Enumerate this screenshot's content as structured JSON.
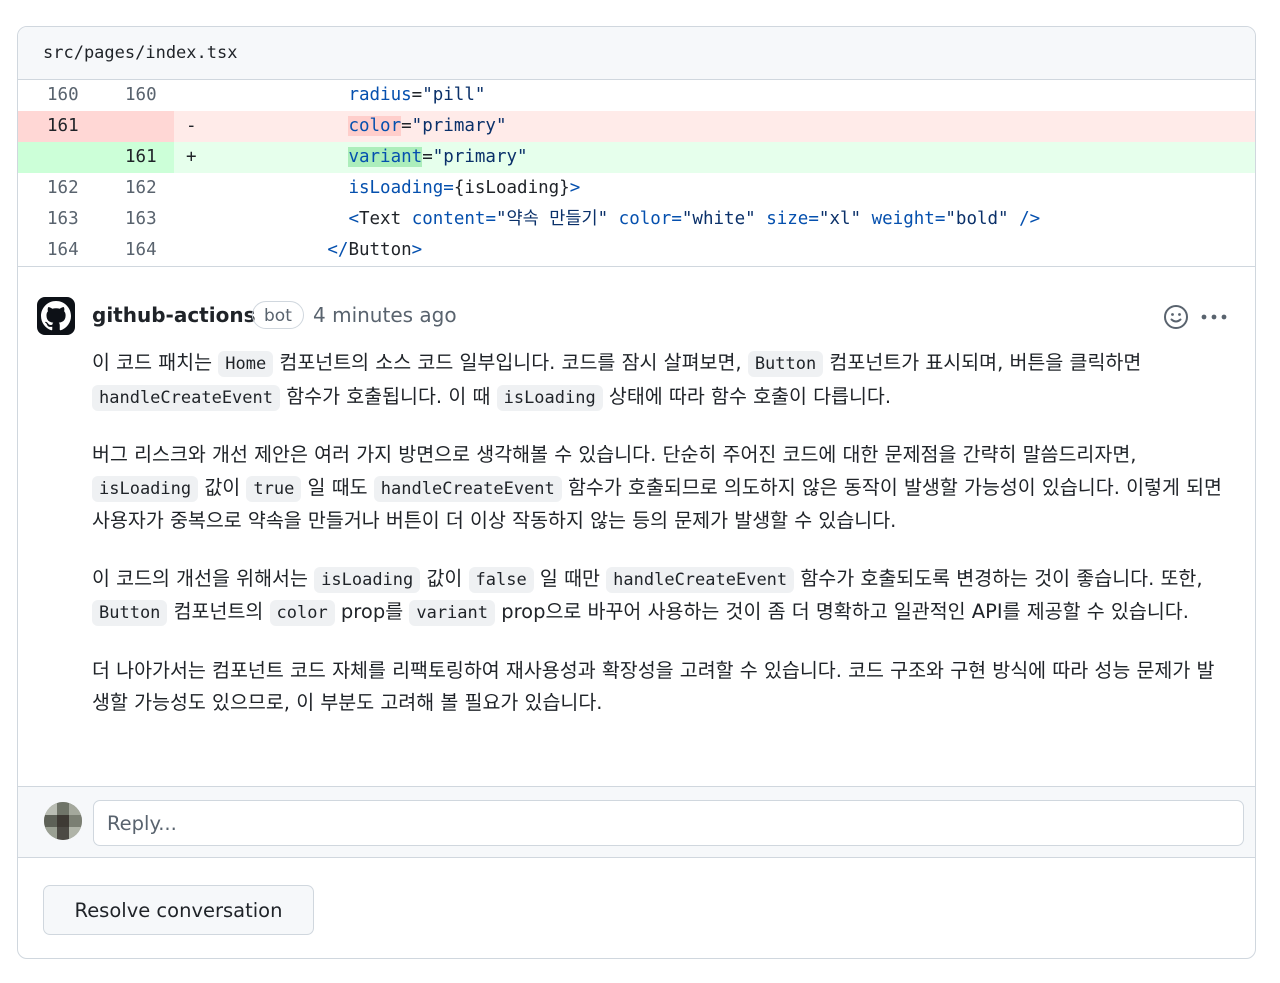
{
  "file": {
    "path": "src/pages/index.tsx"
  },
  "diff": {
    "lines": [
      {
        "old": "160",
        "new": "160",
        "marker": "",
        "type": "context"
      },
      {
        "old": "161",
        "new": "",
        "marker": "-",
        "type": "del"
      },
      {
        "old": "",
        "new": "161",
        "marker": "+",
        "type": "add"
      },
      {
        "old": "162",
        "new": "162",
        "marker": "",
        "type": "context"
      },
      {
        "old": "163",
        "new": "163",
        "marker": "",
        "type": "context"
      },
      {
        "old": "164",
        "new": "164",
        "marker": "",
        "type": "context"
      }
    ],
    "code": {
      "l1_attr": "radius",
      "l1_eq": "=",
      "l1_val": "\"pill\"",
      "l2_attr": "color",
      "l2_eq": "=",
      "l2_val": "\"primary\"",
      "l3_attr": "variant",
      "l3_eq": "=",
      "l3_val": "\"primary\"",
      "l4_attr": "isLoading",
      "l4_eq": "=",
      "l4_val": "{isLoading}",
      "l4_close": ">",
      "l5_open": "<",
      "l5_tag": "Text",
      "l5_a1": "content",
      "l5_v1": "\"약속 만들기\"",
      "l5_a2": "color",
      "l5_v2": "\"white\"",
      "l5_a3": "size",
      "l5_v3": "\"xl\"",
      "l5_a4": "weight",
      "l5_v4": "\"bold\"",
      "l5_end": "/>",
      "l6_open": "</",
      "l6_tag": "Button",
      "l6_close": ">"
    }
  },
  "comment": {
    "author": "github-actions",
    "badge": "bot",
    "time": "4 minutes ago",
    "p1": {
      "t1": "이 코드 패치는 ",
      "c1": "Home",
      "t2": " 컴포넌트의 소스 코드 일부입니다. 코드를 잠시 살펴보면, ",
      "c2": "Button",
      "t3": " 컴포넌트가 표시되며, 버튼을 클릭하면 ",
      "c3": "handleCreateEvent",
      "t4": " 함수가 호출됩니다. 이 때 ",
      "c4": "isLoading",
      "t5": " 상태에 따라 함수 호출이 다릅니다."
    },
    "p2": {
      "t1": "버그 리스크와 개선 제안은 여러 가지 방면으로 생각해볼 수 있습니다. 단순히 주어진 코드에 대한 문제점을 간략히 말씀드리자면, ",
      "c1": "isLoading",
      "t2": " 값이 ",
      "c2": "true",
      "t3": " 일 때도 ",
      "c3": "handleCreateEvent",
      "t4": " 함수가 호출되므로 의도하지 않은 동작이 발생할 가능성이 있습니다. 이렇게 되면 사용자가 중복으로 약속을 만들거나 버튼이 더 이상 작동하지 않는 등의 문제가 발생할 수 있습니다."
    },
    "p3": {
      "t1": "이 코드의 개선을 위해서는 ",
      "c1": "isLoading",
      "t2": " 값이 ",
      "c2": "false",
      "t3": " 일 때만 ",
      "c3": "handleCreateEvent",
      "t4": " 함수가 호출되도록 변경하는 것이 좋습니다. 또한, ",
      "c4": "Button",
      "t5": " 컴포넌트의 ",
      "c5": "color",
      "t6": " prop를 ",
      "c6": "variant",
      "t7": " prop으로 바꾸어 사용하는 것이 좀 더 명확하고 일관적인 API를 제공할 수 있습니다."
    },
    "p4": {
      "t1": "더 나아가서는 컴포넌트 코드 자체를 리팩토링하여 재사용성과 확장성을 고려할 수 있습니다. 코드 구조와 구현 방식에 따라 성능 문제가 발생할 가능성도 있으므로, 이 부분도 고려해 볼 필요가 있습니다."
    }
  },
  "reply": {
    "placeholder": "Reply..."
  },
  "actions": {
    "resolve_label": "Resolve conversation"
  },
  "icons": {
    "author_avatar": "github-mark-icon",
    "emoji": "smiley-icon",
    "more": "kebab-horizontal-icon"
  },
  "colors": {
    "del_bg": "#ffebe9",
    "add_bg": "#e6ffec",
    "border": "#d0d7de"
  }
}
